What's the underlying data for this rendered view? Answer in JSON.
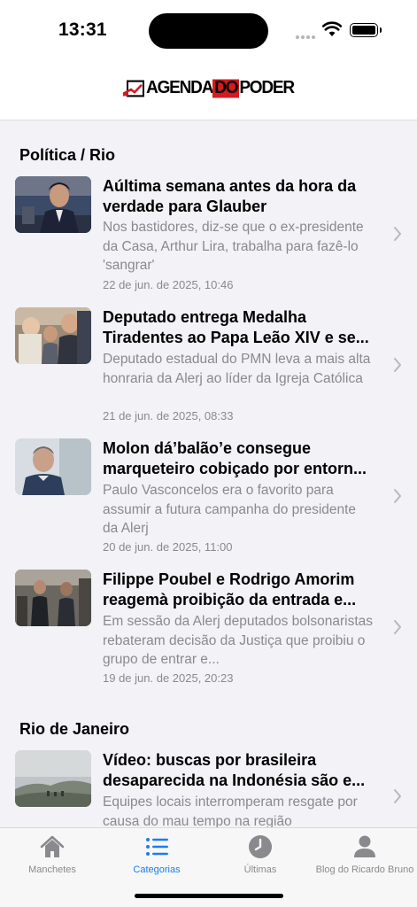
{
  "status_bar": {
    "time": "13:31"
  },
  "header": {
    "logo_text_1": "AGENDA",
    "logo_text_2": "DO",
    "logo_text_3": "PODER"
  },
  "sections": [
    {
      "title": "Política / Rio",
      "articles": [
        {
          "headline": "Aúltima semana antes da hora da verdade para Glauber",
          "summary": "Nos bastidores, diz-se que o ex-presidente da Casa, Arthur Lira, trabalha para fazê-lo 'sangrar'",
          "date": "22 de jun. de 2025, 10:46"
        },
        {
          "headline": "Deputado entrega Medalha Tiradentes ao Papa Leão XIV e se...",
          "summary": "Deputado estadual do PMN leva a mais alta honraria da Alerj ao líder da Igreja Católica",
          "date": "21 de jun. de 2025, 08:33"
        },
        {
          "headline": "Molon dá’balão’e consegue marqueteiro cobiçado por entorn...",
          "summary": "Paulo Vasconcelos era o favorito para assumir a futura campanha do presidente da Alerj",
          "date": "20 de jun. de 2025, 11:00"
        },
        {
          "headline": "Filippe Poubel e Rodrigo Amorim reagemà proibição da entrada e...",
          "summary": "Em sessão da Alerj deputados bolsonaristas rebateram decisão da Justiça que proibiu o grupo de entrar e...",
          "date": "19 de jun. de 2025, 20:23"
        }
      ]
    },
    {
      "title": "Rio de Janeiro",
      "articles": [
        {
          "headline": "Vídeo: buscas por brasileira desaparecida na Indonésia são e...",
          "summary": "Equipes locais interromperam resgate por causa do mau tempo na região",
          "date": ""
        }
      ]
    }
  ],
  "tabbar": {
    "tabs": [
      {
        "label": "Manchetes",
        "icon": "house-icon",
        "active": false
      },
      {
        "label": "Categorias",
        "icon": "list-icon",
        "active": true
      },
      {
        "label": "Últimas",
        "icon": "clock-icon",
        "active": false
      },
      {
        "label": "Blog do Ricardo Bruno",
        "icon": "person-icon",
        "active": false
      }
    ]
  },
  "colors": {
    "accent": "#1a7cf2",
    "brand_red": "#d71920",
    "secondary_text": "#8a8a8e"
  }
}
